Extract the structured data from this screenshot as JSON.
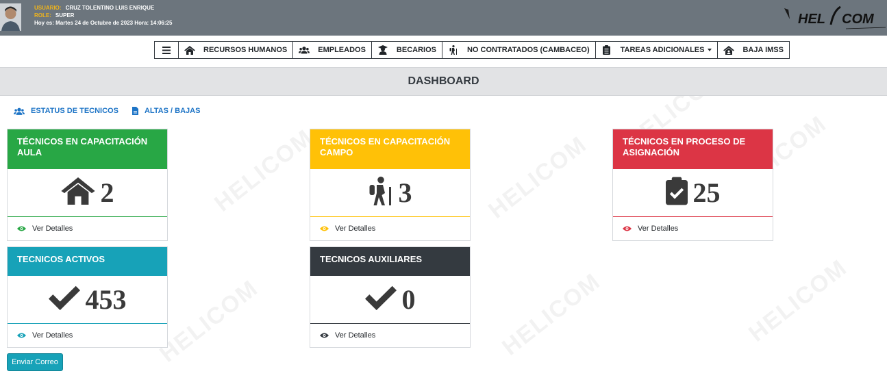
{
  "header": {
    "usuario_label": "USUARIO:",
    "usuario_value": "CRUZ TOLENTINO LUIS ENRIQUE",
    "role_label": "ROLE:",
    "role_value": "SUPER",
    "date_line": "Hoy es: Martes 24 de Octubre de 2023 Hora: 14:06:25",
    "logo_text": "HELICOM"
  },
  "nav": {
    "items": [
      {
        "label": "",
        "icon": "bars-icon"
      },
      {
        "label": "RECURSOS HUMANOS",
        "icon": "home-icon"
      },
      {
        "label": "EMPLEADOS",
        "icon": "users-icon"
      },
      {
        "label": "BECARIOS",
        "icon": "graduate-icon"
      },
      {
        "label": "NO CONTRATADOS (CAMBACEO)",
        "icon": "hiking-icon"
      },
      {
        "label": "TAREAS ADICIONALES",
        "icon": "clipboard-icon"
      },
      {
        "label": "BAJA IMSS",
        "icon": "house-user-icon"
      }
    ]
  },
  "page_title": "DASHBOARD",
  "sublinks": [
    {
      "label": "ESTATUS DE TECNICOS",
      "icon": "users-icon"
    },
    {
      "label": "ALTAS / BAJAS",
      "icon": "file-icon"
    }
  ],
  "cards": [
    {
      "title": "TÉCNICOS EN CAPACITACIÓN AULA",
      "value": "2",
      "icon": "home-icon",
      "footer": "Ver Detalles",
      "color": "#28a745"
    },
    {
      "title": "TÉCNICOS EN CAPACITACIÓN CAMPO",
      "value": "3",
      "icon": "hiking-icon",
      "footer": "Ver Detalles",
      "color": "#ffc107"
    },
    {
      "title": "TÉCNICOS EN PROCESO DE ASIGNACIÓN",
      "value": "25",
      "icon": "clipboard-check-icon",
      "footer": "Ver Detalles",
      "color": "#dc3545"
    },
    {
      "title": "TECNICOS ACTIVOS",
      "value": "453",
      "icon": "check-icon",
      "footer": "Ver Detalles",
      "color": "#17a2b8"
    },
    {
      "title": "TECNICOS AUXILIARES",
      "value": "0",
      "icon": "check-icon",
      "footer": "Ver Detalles",
      "color": "#343a40"
    }
  ],
  "actions": {
    "send_mail": "Enviar Correo"
  }
}
